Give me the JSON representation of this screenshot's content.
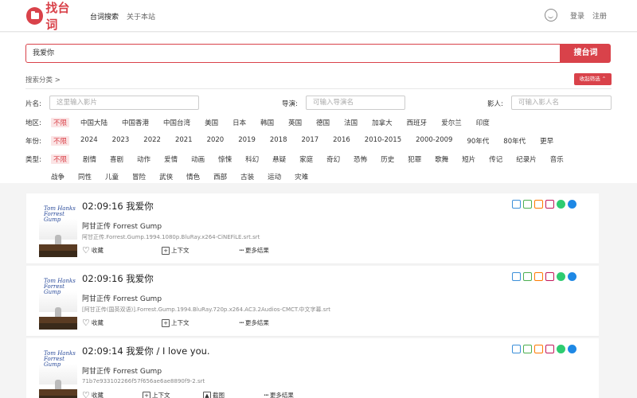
{
  "header": {
    "logo_text": "找台词",
    "nav": [
      "台词搜索",
      "关于本站"
    ],
    "login": "登录",
    "register": "注册"
  },
  "search": {
    "value": "我爱你",
    "button": "搜台词"
  },
  "category": {
    "title": "搜索分类 >",
    "collapse": "收起筛选 ⌃"
  },
  "filters": {
    "movie_label": "片名:",
    "movie_placeholder": "这里输入影片",
    "director_label": "导演:",
    "director_placeholder": "可输入导演名",
    "actor_label": "影人:",
    "actor_placeholder": "可输入影人名",
    "region_label": "地区:",
    "regions": [
      "不限",
      "中国大陆",
      "中国香港",
      "中国台湾",
      "美国",
      "日本",
      "韩国",
      "英国",
      "德国",
      "法国",
      "加拿大",
      "西班牙",
      "爱尔兰",
      "印度"
    ],
    "year_label": "年份:",
    "years": [
      "不限",
      "2024",
      "2023",
      "2022",
      "2021",
      "2020",
      "2019",
      "2018",
      "2017",
      "2016",
      "2010-2015",
      "2000-2009",
      "90年代",
      "80年代",
      "更早"
    ],
    "type_label": "类型:",
    "types": [
      "不限",
      "剧情",
      "喜剧",
      "动作",
      "爱情",
      "动画",
      "惊悚",
      "科幻",
      "悬疑",
      "家庭",
      "奇幻",
      "恐怖",
      "历史",
      "犯罪",
      "歌舞",
      "短片",
      "传记",
      "纪录片",
      "音乐",
      "战争",
      "同性",
      "儿童",
      "冒险",
      "武侠",
      "情色",
      "西部",
      "古装",
      "运动",
      "灾难"
    ]
  },
  "results": [
    {
      "time": "02:09:16 我爱你",
      "movie": "阿甘正传 Forrest Gump",
      "file": "阿甘正传.Forrest.Gump.1994.1080p.BluRay.x264-CiNEFiLE.srt.srt",
      "fav": "收藏",
      "context": "上下文",
      "more": "更多结果",
      "poster_title": "Tom Hanks\nForrest\nGump"
    },
    {
      "time": "02:09:16 我爱你",
      "movie": "阿甘正传 Forrest Gump",
      "file": "[阿甘正传(国英双语)].Forrest.Gump.1994.BluRay.720p.x264.AC3.2Audios-CMCT.中文字幕.srt",
      "fav": "收藏",
      "context": "上下文",
      "more": "更多结果",
      "poster_title": "Tom Hanks\nForrest\nGump"
    },
    {
      "time": "02:09:14 我爱你 / I love you.",
      "movie": "阿甘正传 Forrest Gump",
      "file": "71b7e933102266f57f656ae6ae8890f9-2.srt",
      "fav": "收藏",
      "context": "上下文",
      "screenshot": "截图",
      "more": "更多结果",
      "poster_title": "Tom Hanks\nForrest\nGump"
    }
  ],
  "player_colors": [
    "#3b8fd9",
    "#4caf50",
    "#ff7a00",
    "#c2185b",
    "#2ecc71",
    "#1e88e5"
  ]
}
